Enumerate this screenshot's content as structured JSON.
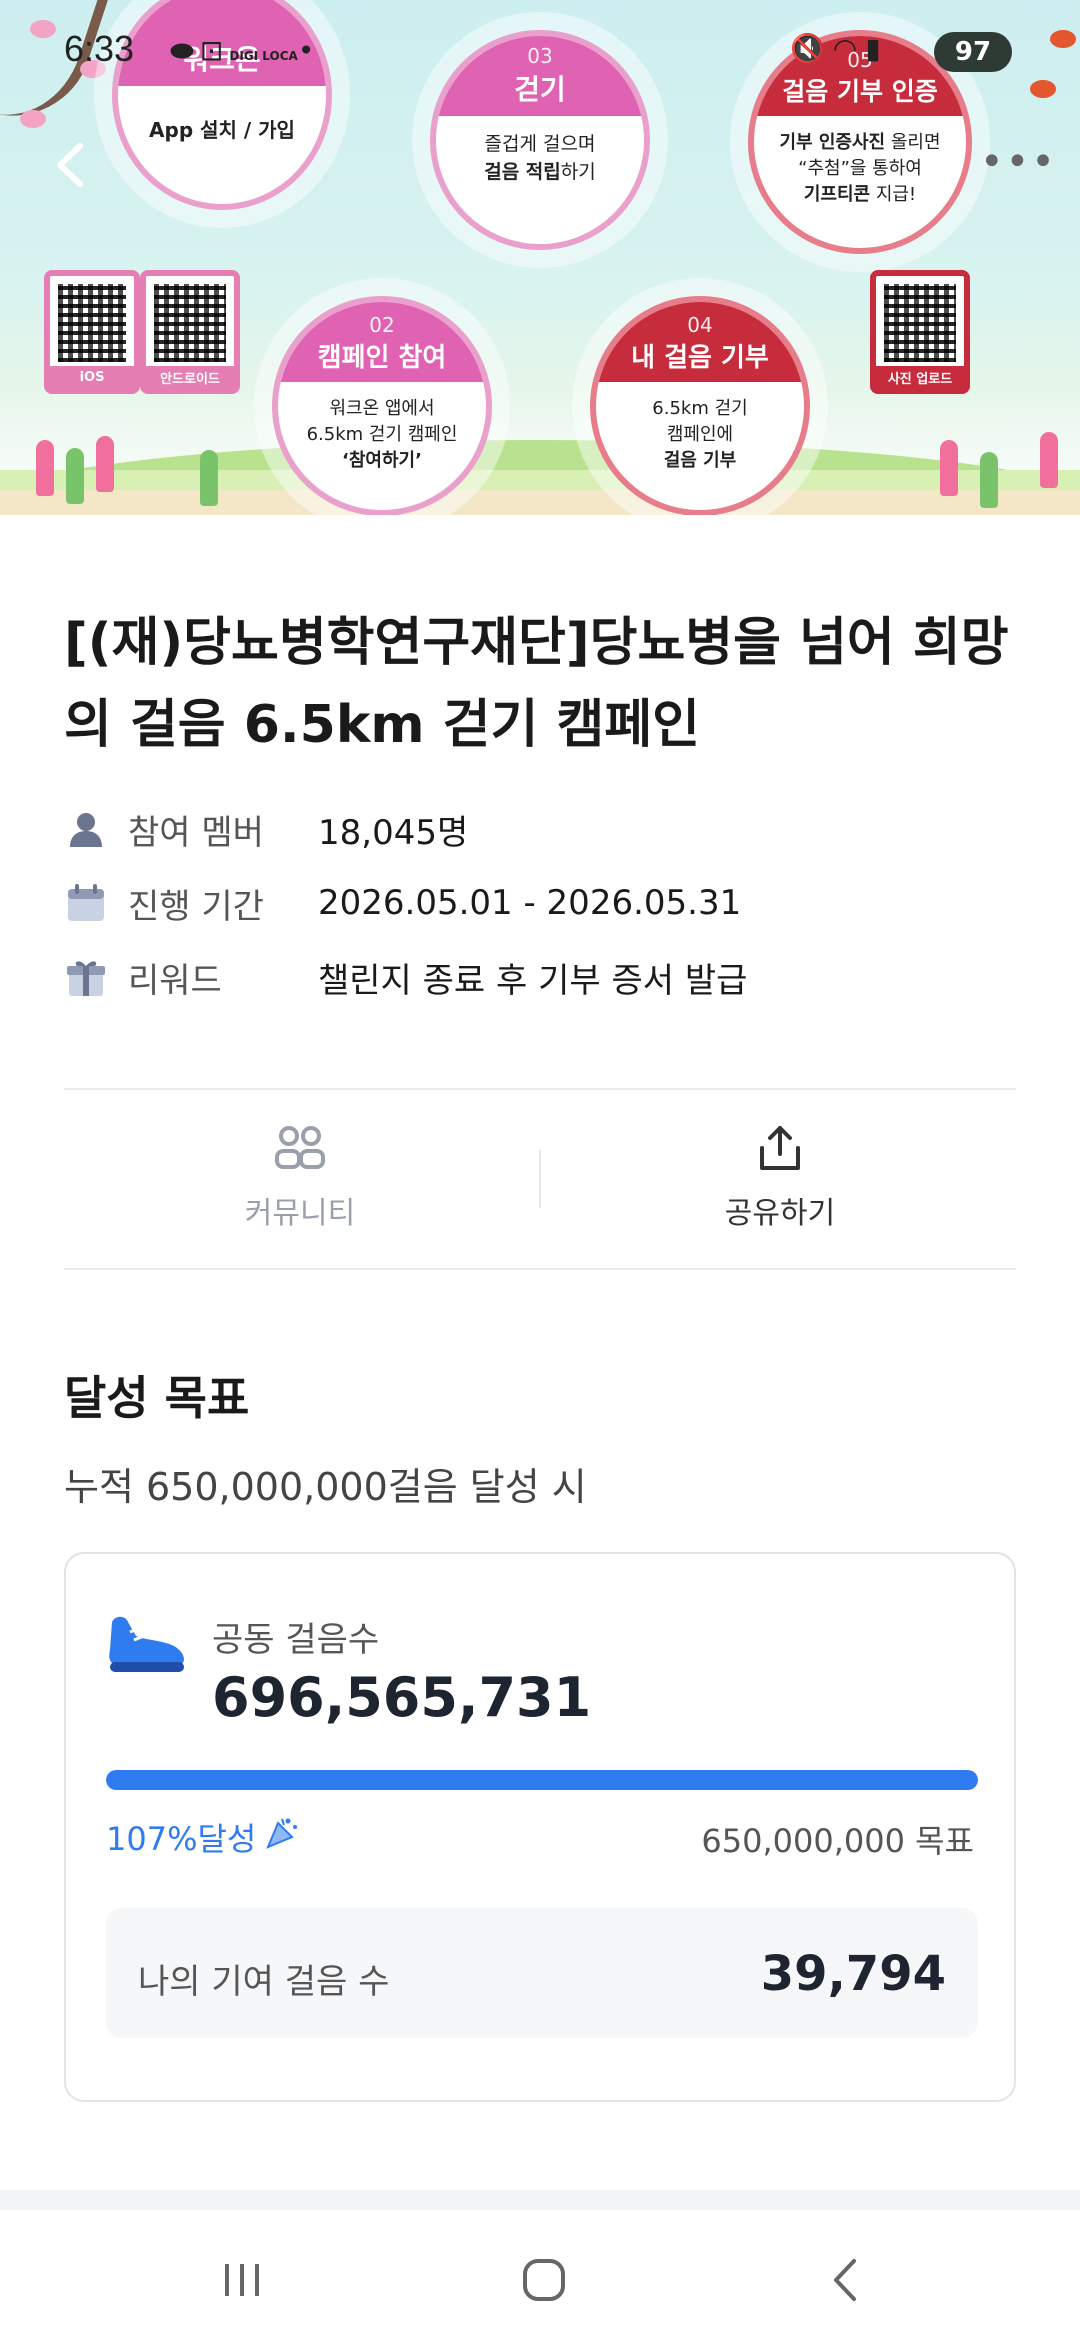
{
  "status_bar": {
    "time": "6:33",
    "battery": "97",
    "digi_loca": "DIGI LOCA"
  },
  "hero": {
    "step1": {
      "title": "워크온",
      "text": "App 설치 / 가입"
    },
    "step2": {
      "num": "02",
      "title": "캠페인 참여",
      "line1": "워크온 앱에서",
      "line2": "6.5km 걷기 캠페인",
      "line3": "‘참여하기’"
    },
    "step3": {
      "num": "03",
      "title": "걷기",
      "line1": "즐겁게 걸으며",
      "line2_bold": "걸음 적립",
      "line2_rest": "하기"
    },
    "step4": {
      "num": "04",
      "title": "내 걸음 기부",
      "line1": "6.5km 걷기",
      "line2": "캠페인에",
      "line3": "걸음 기부"
    },
    "step5": {
      "num": "05",
      "title": "걸음 기부 인증",
      "line1_bold": "기부 인증사진",
      "line1_rest": " 올리면",
      "line2": "“추첨”을 통하여",
      "line3_bold": "기프티콘",
      "line3_rest": " 지급!"
    },
    "qr_ios": "iOS",
    "qr_android": "안드로이드",
    "qr_photo": "사진 업로드"
  },
  "campaign": {
    "title": "[(재)당뇨병학연구재단]당뇨병을 넘어 희망의 걸음 6.5km 걷기 캠페인",
    "members_label": "참여 멤버",
    "members_value": "18,045명",
    "period_label": "진행 기간",
    "period_value": "2026.05.01 - 2026.05.31",
    "reward_label": "리워드",
    "reward_value": "챌린지 종료 후 기부 증서 발급"
  },
  "actions": {
    "community": "커뮤니티",
    "share": "공유하기"
  },
  "goal": {
    "title": "달성 목표",
    "subtitle": "누적 650,000,000걸음 달성 시",
    "steps_label": "공동 걸음수",
    "steps_value": "696,565,731",
    "progress_percent": 100,
    "achieved_text": "107%달성",
    "target_text": "650,000,000 목표",
    "my_label": "나의 기여 걸음 수",
    "my_value": "39,794"
  },
  "colors": {
    "accent": "#2f7cf0",
    "pink": "#e062b2",
    "red": "#c72c3c"
  },
  "icons": [
    "back-arrow-icon",
    "more-dots-icon",
    "person-icon",
    "calendar-icon",
    "gift-icon",
    "community-icon",
    "share-icon",
    "shoe-icon",
    "party-popper-icon",
    "recent-apps-icon",
    "home-icon",
    "nav-back-icon"
  ]
}
